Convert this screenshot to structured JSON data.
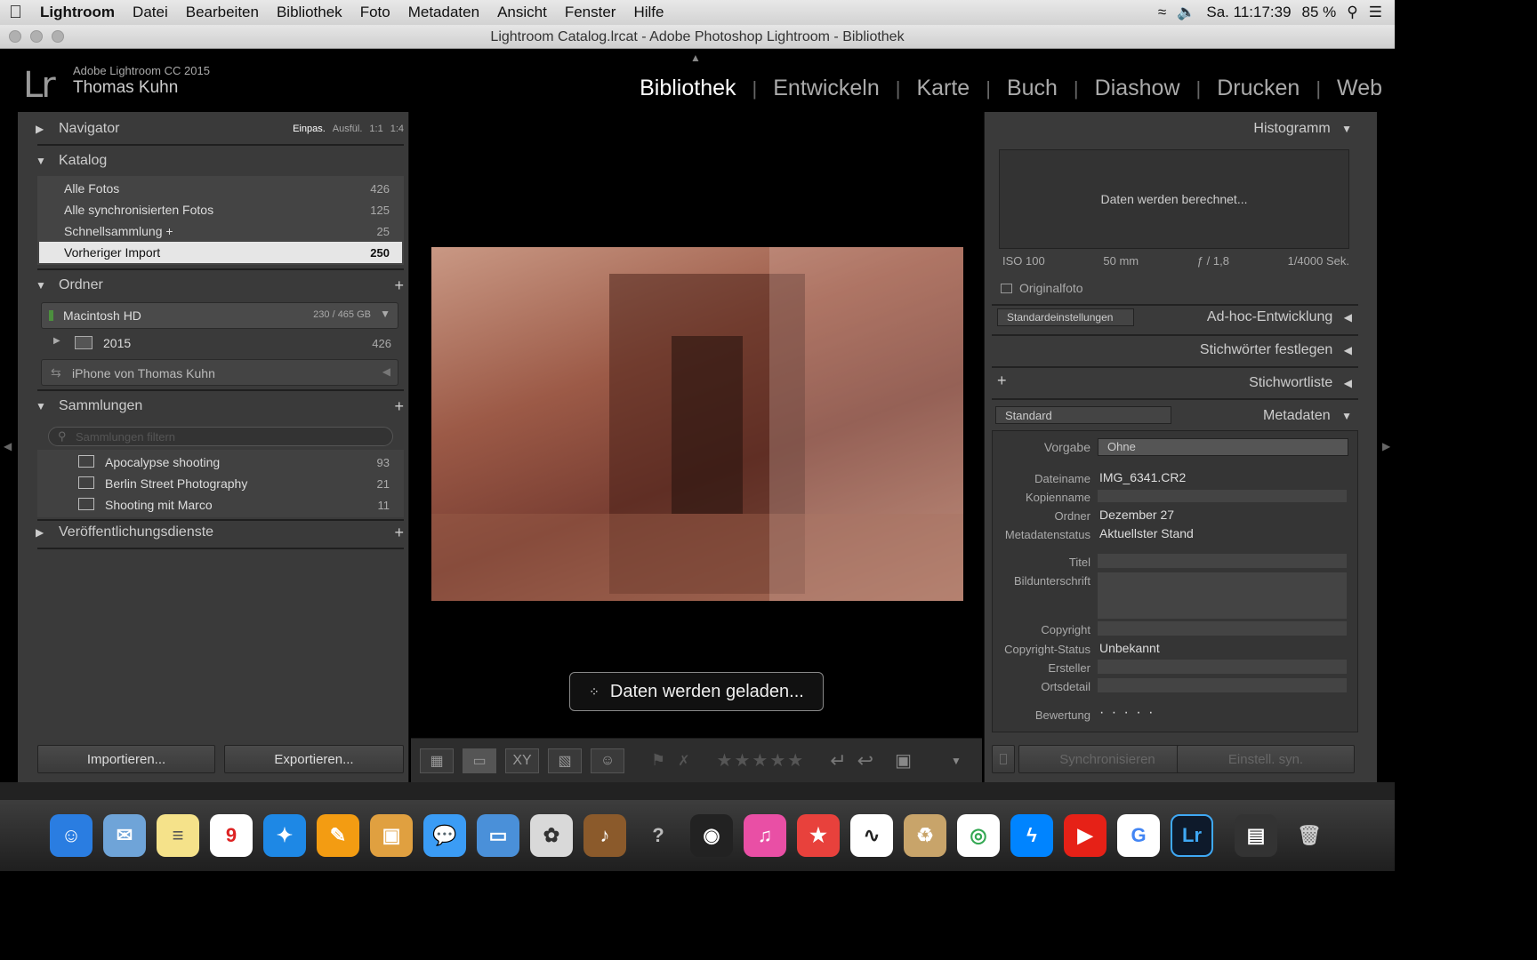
{
  "menubar": {
    "app": "Lightroom",
    "items": [
      "Datei",
      "Bearbeiten",
      "Bibliothek",
      "Foto",
      "Metadaten",
      "Ansicht",
      "Fenster",
      "Hilfe"
    ],
    "clock": "Sa. 11:17:39",
    "battery": "85 %"
  },
  "window": {
    "title": "Lightroom Catalog.lrcat - Adobe Photoshop Lightroom - Bibliothek"
  },
  "identity": {
    "logo": "Lr",
    "product": "Adobe Lightroom CC 2015",
    "user": "Thomas Kuhn"
  },
  "modules": [
    "Bibliothek",
    "Entwickeln",
    "Karte",
    "Buch",
    "Diashow",
    "Drucken",
    "Web"
  ],
  "left": {
    "navigator": {
      "title": "Navigator",
      "zoom": [
        "Einpas.",
        "Ausfül.",
        "1:1",
        "1:4"
      ]
    },
    "catalog": {
      "title": "Katalog",
      "items": [
        {
          "label": "Alle Fotos",
          "count": "426"
        },
        {
          "label": "Alle synchronisierten Fotos",
          "count": "125"
        },
        {
          "label": "Schnellsammlung +",
          "count": "25"
        },
        {
          "label": "Vorheriger Import",
          "count": "250"
        }
      ]
    },
    "folders": {
      "title": "Ordner",
      "volume": "Macintosh HD",
      "volume_space": "230 / 465 GB",
      "folder": "2015",
      "folder_count": "426",
      "device": "iPhone von Thomas Kuhn"
    },
    "collections": {
      "title": "Sammlungen",
      "filter_placeholder": "Sammlungen filtern",
      "items": [
        {
          "label": "Apocalypse shooting",
          "count": "93"
        },
        {
          "label": "Berlin Street Photography",
          "count": "21"
        },
        {
          "label": "Shooting mit Marco",
          "count": "11"
        }
      ]
    },
    "publish": {
      "title": "Veröffentlichungsdienste"
    },
    "import_label": "Importieren...",
    "export_label": "Exportieren..."
  },
  "center": {
    "loading": "Daten werden geladen..."
  },
  "right": {
    "histogram": {
      "title": "Histogramm",
      "status": "Daten werden berechnet...",
      "iso": "ISO 100",
      "focal": "50 mm",
      "aperture": "ƒ / 1,8",
      "shutter": "1/4000 Sek.",
      "original": "Originalfoto"
    },
    "quick_develop": {
      "preset": "Standardeinstellungen",
      "title": "Ad-hoc-Entwicklung"
    },
    "keywording": {
      "title": "Stichwörter festlegen"
    },
    "keyword_list": {
      "title": "Stichwortliste"
    },
    "metadata": {
      "preset_select": "Standard",
      "title": "Metadaten",
      "vorgabe_label": "Vorgabe",
      "vorgabe_value": "Ohne",
      "fields": [
        {
          "label": "Dateiname",
          "value": "IMG_6341.CR2"
        },
        {
          "label": "Kopienname",
          "value": ""
        },
        {
          "label": "Ordner",
          "value": "Dezember 27"
        },
        {
          "label": "Metadatenstatus",
          "value": "Aktuellster Stand"
        }
      ],
      "fields2": [
        {
          "label": "Titel",
          "value": ""
        },
        {
          "label": "Bildunterschrift",
          "value": ""
        },
        {
          "label": "Copyright",
          "value": ""
        },
        {
          "label": "Copyright-Status",
          "value": "Unbekannt"
        },
        {
          "label": "Ersteller",
          "value": ""
        },
        {
          "label": "Ortsdetail",
          "value": ""
        },
        {
          "label": "Bewertung",
          "value": "· · · · ·"
        }
      ]
    },
    "sync_label": "Synchronisieren",
    "sync_settings_label": "Einstell. syn."
  },
  "dock": [
    "Finder",
    "Mail",
    "Notizen",
    "Kalender",
    "Safari",
    "Pages",
    "Vorschau",
    "Nachrichten",
    "Keynote",
    "Fotos",
    "GarageBand",
    "Hilfe",
    "Kamera",
    "iTunes",
    "Bookmarks",
    "Wunderlist",
    "Archiv",
    "Chrome",
    "Messenger",
    "YouTube",
    "Google",
    "Lightroom",
    "Downloads",
    "Papierkorb"
  ],
  "colors": {
    "accent": "#e0e0e0",
    "panel": "#3a3a3a",
    "bg": "#000000"
  }
}
